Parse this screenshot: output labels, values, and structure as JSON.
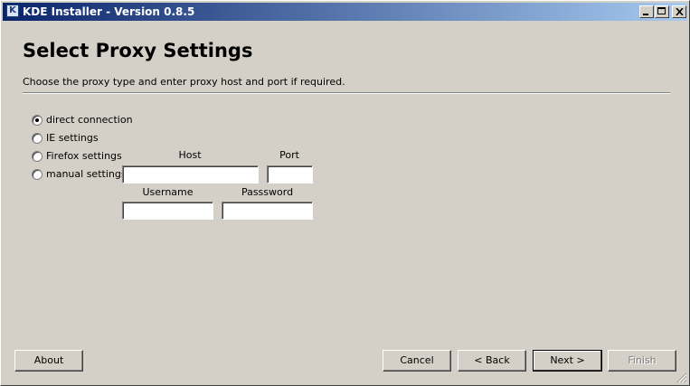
{
  "window": {
    "title": "KDE Installer - Version 0.8.5",
    "app_icon_letter": "K"
  },
  "page": {
    "title": "Select Proxy Settings",
    "subtitle": "Choose the proxy type and enter proxy host and port if required."
  },
  "proxy_options": [
    {
      "label": "direct connection",
      "checked": true
    },
    {
      "label": "IE settings",
      "checked": false
    },
    {
      "label": "Firefox settings",
      "checked": false
    },
    {
      "label": "manual settings",
      "checked": false
    }
  ],
  "fields": {
    "host_label": "Host",
    "port_label": "Port",
    "username_label": "Username",
    "password_label": "Passsword",
    "host_value": "",
    "port_value": "",
    "username_value": "",
    "password_value": ""
  },
  "buttons": {
    "about": "About",
    "cancel": "Cancel",
    "back": "< Back",
    "next": "Next >",
    "finish": "Finish"
  }
}
